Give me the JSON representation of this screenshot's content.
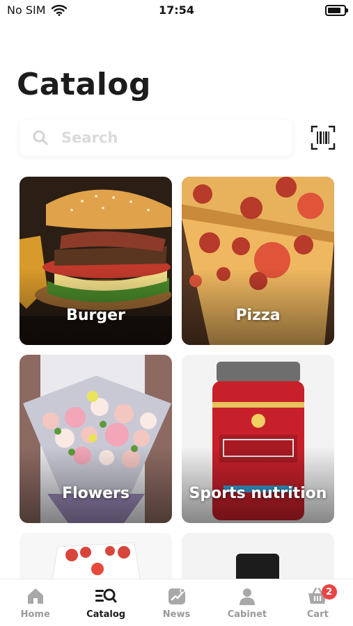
{
  "status": {
    "carrier": "No SIM",
    "time": "17:54"
  },
  "title": "Catalog",
  "search": {
    "placeholder": "Search"
  },
  "categories": [
    {
      "label": "Burger"
    },
    {
      "label": "Pizza"
    },
    {
      "label": "Flowers"
    },
    {
      "label": "Sports nutrition"
    }
  ],
  "tabs": [
    {
      "label": "Home",
      "icon": "home-icon"
    },
    {
      "label": "Catalog",
      "icon": "catalog-search-icon"
    },
    {
      "label": "News",
      "icon": "news-chart-icon"
    },
    {
      "label": "Cabinet",
      "icon": "person-icon"
    },
    {
      "label": "Cart",
      "icon": "cart-icon",
      "badge": "2"
    }
  ],
  "colors": {
    "badge": "#e84545",
    "active_tab": "#1c1c1c",
    "inactive_tab": "#9a9a9a"
  }
}
